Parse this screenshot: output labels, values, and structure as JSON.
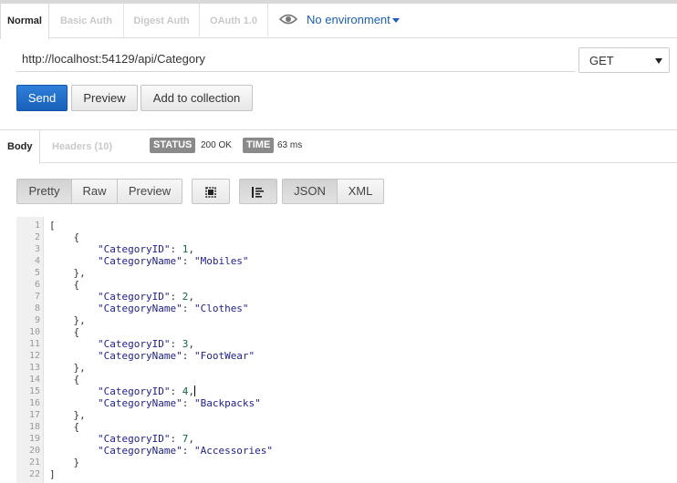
{
  "request_tabs": [
    {
      "label": "Normal",
      "active": true
    },
    {
      "label": "Basic Auth",
      "active": false
    },
    {
      "label": "Digest Auth",
      "active": false
    },
    {
      "label": "OAuth 1.0",
      "active": false
    }
  ],
  "environment": {
    "label": "No environment",
    "icon": "eye-icon"
  },
  "request": {
    "url": "http://localhost:54129/api/Category",
    "method": "GET"
  },
  "actions": {
    "send_label": "Send",
    "preview_label": "Preview",
    "add_collection_label": "Add to collection"
  },
  "response": {
    "tabs": [
      {
        "label": "Body",
        "active": true
      },
      {
        "label": "Headers (10)",
        "active": false
      }
    ],
    "status_label": "STATUS",
    "status_value": "200 OK",
    "time_label": "TIME",
    "time_value": "63 ms"
  },
  "view_toolbar": {
    "modes": [
      "Pretty",
      "Raw",
      "Preview"
    ],
    "selected_mode": "Pretty",
    "formats": [
      "JSON",
      "XML"
    ],
    "selected_format": "JSON",
    "expand_icon": "expand-icon",
    "wrap_icon": "wrap-lines-icon"
  },
  "colors": {
    "accent": "#1a5fb4",
    "send_button": "#1f6cc4",
    "badge": "#8a8a8a",
    "json_key": "#1e1e8c",
    "json_number": "#116644"
  },
  "body": {
    "lines": [
      {
        "n": "1",
        "text": "["
      },
      {
        "n": "2",
        "text": "    {"
      },
      {
        "n": "3",
        "text": "        \"CategoryID\": 1,"
      },
      {
        "n": "4",
        "text": "        \"CategoryName\": \"Mobiles\""
      },
      {
        "n": "5",
        "text": "    },"
      },
      {
        "n": "6",
        "text": "    {"
      },
      {
        "n": "7",
        "text": "        \"CategoryID\": 2,"
      },
      {
        "n": "8",
        "text": "        \"CategoryName\": \"Clothes\""
      },
      {
        "n": "9",
        "text": "    },"
      },
      {
        "n": "10",
        "text": "    {"
      },
      {
        "n": "11",
        "text": "        \"CategoryID\": 3,"
      },
      {
        "n": "12",
        "text": "        \"CategoryName\": \"FootWear\""
      },
      {
        "n": "13",
        "text": "    },"
      },
      {
        "n": "14",
        "text": "    {"
      },
      {
        "n": "15",
        "text": "        \"CategoryID\": 4,"
      },
      {
        "n": "16",
        "text": "        \"CategoryName\": \"Backpacks\""
      },
      {
        "n": "17",
        "text": "    },"
      },
      {
        "n": "18",
        "text": "    {"
      },
      {
        "n": "19",
        "text": "        \"CategoryID\": 7,"
      },
      {
        "n": "20",
        "text": "        \"CategoryName\": \"Accessories\""
      },
      {
        "n": "21",
        "text": "    }"
      },
      {
        "n": "22",
        "text": "]"
      }
    ]
  }
}
